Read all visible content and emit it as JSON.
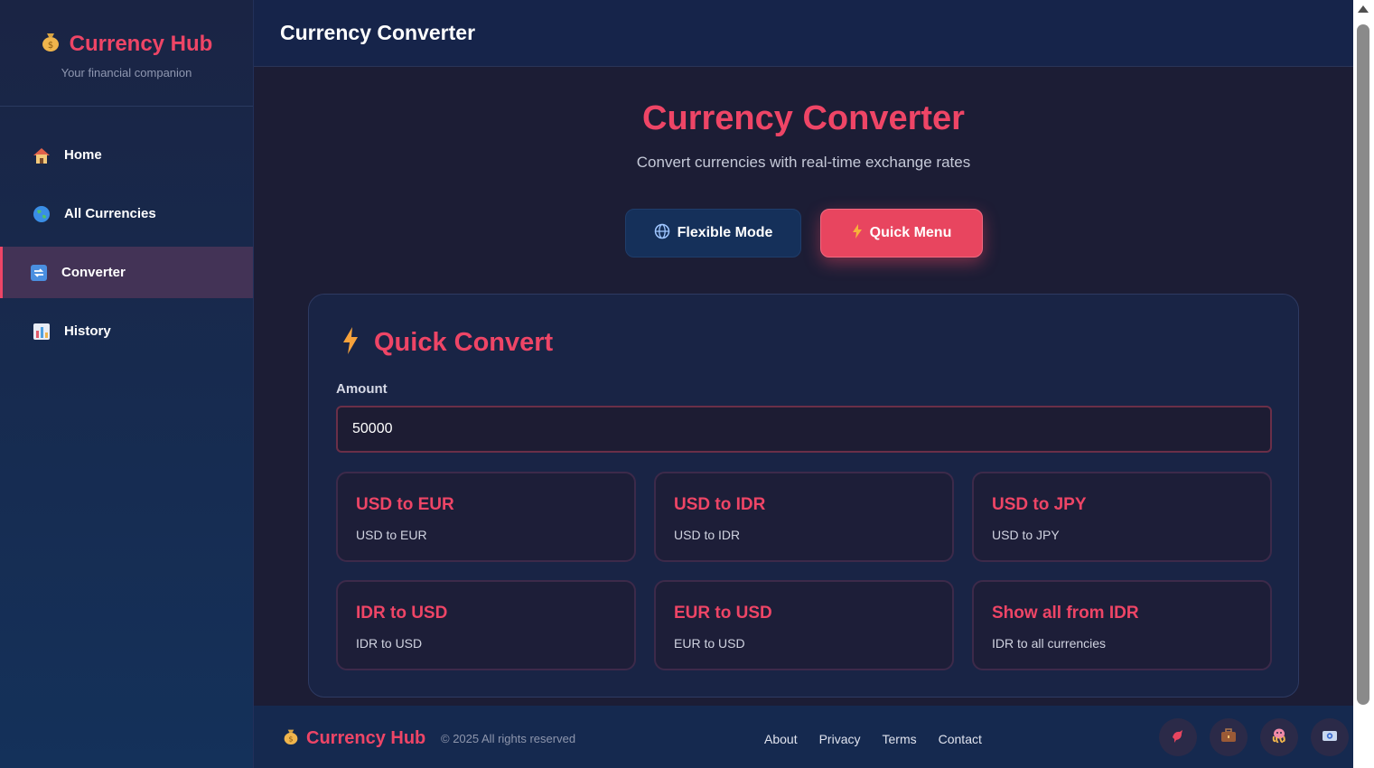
{
  "sidebar": {
    "brand": {
      "icon": "money-bag-icon",
      "name": "Currency Hub",
      "tagline": "Your financial companion"
    },
    "items": [
      {
        "label": "Home",
        "icon": "house-icon",
        "active": false
      },
      {
        "label": "All Currencies",
        "icon": "globe-icon",
        "active": false
      },
      {
        "label": "Converter",
        "icon": "exchange-icon",
        "active": true
      },
      {
        "label": "History",
        "icon": "bar-chart-icon",
        "active": false
      }
    ]
  },
  "header": {
    "title": "Currency Converter"
  },
  "main": {
    "title": "Currency Converter",
    "subtitle": "Convert currencies with real-time exchange rates",
    "modes": [
      {
        "label": "Flexible Mode",
        "icon": "globe-icon"
      },
      {
        "label": "Quick Menu",
        "icon": "lightning-icon"
      }
    ],
    "quick_convert": {
      "title": "Quick Convert",
      "icon": "lightning-icon",
      "amount_label": "Amount",
      "amount_value": "50000",
      "options": [
        {
          "title": "USD to EUR",
          "desc": "USD to EUR"
        },
        {
          "title": "USD to IDR",
          "desc": "USD to IDR"
        },
        {
          "title": "USD to JPY",
          "desc": "USD to JPY"
        },
        {
          "title": "IDR to USD",
          "desc": "IDR to USD"
        },
        {
          "title": "EUR to USD",
          "desc": "EUR to USD"
        },
        {
          "title": "Show all from IDR",
          "desc": "IDR to all currencies"
        }
      ]
    }
  },
  "footer": {
    "brand": "Currency Hub",
    "copyright": "© 2025 All rights reserved",
    "links": [
      "About",
      "Privacy",
      "Terms",
      "Contact"
    ],
    "socials": [
      "bird-icon",
      "briefcase-icon",
      "octopus-icon",
      "camera-icon"
    ]
  },
  "colors": {
    "accent": "#ee4566",
    "sidebar": "#1a2444",
    "background": "#1c1d35",
    "card": "#192445"
  }
}
